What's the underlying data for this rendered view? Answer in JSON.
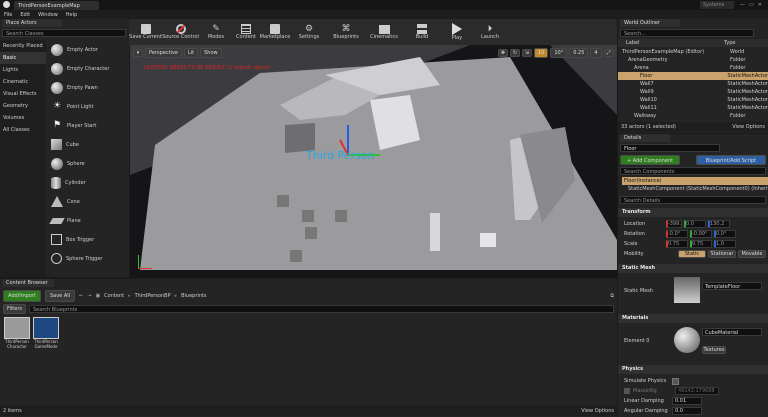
{
  "window": {
    "tab_title": "ThirdPersonExampleMap",
    "brand": "Systems",
    "menu": [
      "File",
      "Edit",
      "Window",
      "Help"
    ]
  },
  "place_actors": {
    "title": "Place Actors",
    "search_placeholder": "Search Classes",
    "categories": [
      "Recently Placed",
      "Basic",
      "Lights",
      "Cinematic",
      "Visual Effects",
      "Geometry",
      "Volumes",
      "All Classes"
    ],
    "items": [
      "Empty Actor",
      "Empty Character",
      "Empty Pawn",
      "Point Light",
      "Player Start",
      "Cube",
      "Sphere",
      "Cylinder",
      "Cone",
      "Plane",
      "Box Trigger",
      "Sphere Trigger"
    ]
  },
  "toolbar": [
    "Save Current",
    "Source Control",
    "Modes",
    "Content",
    "Marketplace",
    "Settings",
    "Blueprints",
    "Cinematics",
    "Build",
    "Play",
    "Launch"
  ],
  "viewport": {
    "perspective": "Perspective",
    "lit": "Lit",
    "show": "Show",
    "warning": "LIGHTING NEEDS TO BE REBUILT (1 unbuilt object)",
    "player_label": "Third Person",
    "grid": "10",
    "rot": "10°",
    "scale": "0.25",
    "cams": "4"
  },
  "outliner": {
    "title": "World Outliner",
    "search_placeholder": "Search...",
    "col_label": "Label",
    "col_type": "Type",
    "rows": [
      {
        "label": "ThirdPersonExampleMap (Editor)",
        "type": "World"
      },
      {
        "label": "ArenaGeometry",
        "type": "Folder"
      },
      {
        "label": "Arena",
        "type": "Folder"
      },
      {
        "label": "Floor",
        "type": "StaticMeshActor"
      },
      {
        "label": "Wall7",
        "type": "StaticMeshActor"
      },
      {
        "label": "Wall9",
        "type": "StaticMeshActor"
      },
      {
        "label": "Wall10",
        "type": "StaticMeshActor"
      },
      {
        "label": "Wall11",
        "type": "StaticMeshActor"
      },
      {
        "label": "Walkway",
        "type": "Folder"
      }
    ],
    "status": "33 actors (1 selected)",
    "view_options": "View Options"
  },
  "details": {
    "title": "Details",
    "name": "Floor",
    "add_component": "+ Add Component",
    "blueprint_btn": "Blueprint/Add Script",
    "search_components": "Search Components",
    "instance": "Floor(Instance)",
    "component": "StaticMeshComponent (StaticMeshComponent0) (Inherited)",
    "search_details": "Search Details",
    "transform": "Transform",
    "location": {
      "label": "Location",
      "x": "-399.",
      "y": "0.0",
      "z": "130.2"
    },
    "rotation": {
      "label": "Rotation",
      "x": "-0.0°",
      "y": "-0.00°",
      "z": "0.0°"
    },
    "scale": {
      "label": "Scale",
      "x": "0.75",
      "y": "0.75",
      "z": "1.0"
    },
    "mobility": {
      "label": "Mobility",
      "options": [
        "Static",
        "Stationar",
        "Movable"
      ]
    },
    "static_mesh_section": "Static Mesh",
    "static_mesh_label": "Static Mesh",
    "static_mesh_value": "TemplateFloor",
    "materials_section": "Materials",
    "element_label": "Element 0",
    "material_value": "CubeMaterial",
    "textures": "Textures",
    "physics_section": "Physics",
    "simulate_physics": "Simulate Physics",
    "massinkg": "MassInKg",
    "mass_value": "49142.179688",
    "linear_damping": "Linear Damping",
    "linear_value": "0.01",
    "angular_damping": "Angular Damping",
    "angular_value": "0.0"
  },
  "content_browser": {
    "tab": "Content Browser",
    "add_import": "Add/Import",
    "save_all": "Save All",
    "path": [
      "Content",
      "ThirdPersonBP",
      "Blueprints"
    ],
    "filters": "Filters",
    "search_placeholder": "Search Blueprints",
    "assets": [
      {
        "name": "ThirdPerson Character"
      },
      {
        "name": "ThirdPerson GameMode"
      }
    ],
    "status": "2 items",
    "view_options": "View Options"
  },
  "colors": {
    "accent": "#2e7d1e",
    "selected_row": "#c9a36b",
    "blueprint": "#2f5fa3",
    "warning": "#e02020",
    "player_label": "#25a8e0"
  }
}
